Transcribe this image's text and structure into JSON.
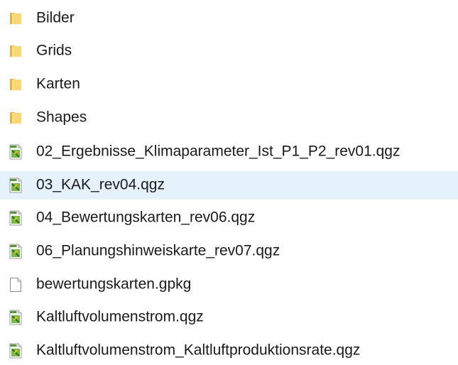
{
  "files": [
    {
      "name": "Bilder",
      "type": "folder",
      "icon": "folder-icon",
      "selected": false
    },
    {
      "name": "Grids",
      "type": "folder",
      "icon": "folder-icon",
      "selected": false
    },
    {
      "name": "Karten",
      "type": "folder",
      "icon": "folder-icon",
      "selected": false
    },
    {
      "name": "Shapes",
      "type": "folder",
      "icon": "folder-icon",
      "selected": false
    },
    {
      "name": "02_Ergebnisse_Klimaparameter_Ist_P1_P2_rev01.qgz",
      "type": "qgz",
      "icon": "qgis-project-icon",
      "selected": false
    },
    {
      "name": "03_KAK_rev04.qgz",
      "type": "qgz",
      "icon": "qgis-project-icon",
      "selected": true
    },
    {
      "name": "04_Bewertungskarten_rev06.qgz",
      "type": "qgz",
      "icon": "qgis-project-icon",
      "selected": false
    },
    {
      "name": "06_Planungshinweiskarte_rev07.qgz",
      "type": "qgz",
      "icon": "qgis-project-icon",
      "selected": false
    },
    {
      "name": "bewertungskarten.gpkg",
      "type": "generic",
      "icon": "generic-file-icon",
      "selected": false
    },
    {
      "name": "Kaltluftvolumenstrom.qgz",
      "type": "qgz",
      "icon": "qgis-project-icon",
      "selected": false
    },
    {
      "name": "Kaltluftvolumenstrom_Kaltluftproduktionsrate.qgz",
      "type": "qgz",
      "icon": "qgis-project-icon",
      "selected": false
    }
  ],
  "colors": {
    "selection_background": "#e5f1fb",
    "folder_yellow": "#f8d775",
    "qgis_green": "#589632"
  }
}
